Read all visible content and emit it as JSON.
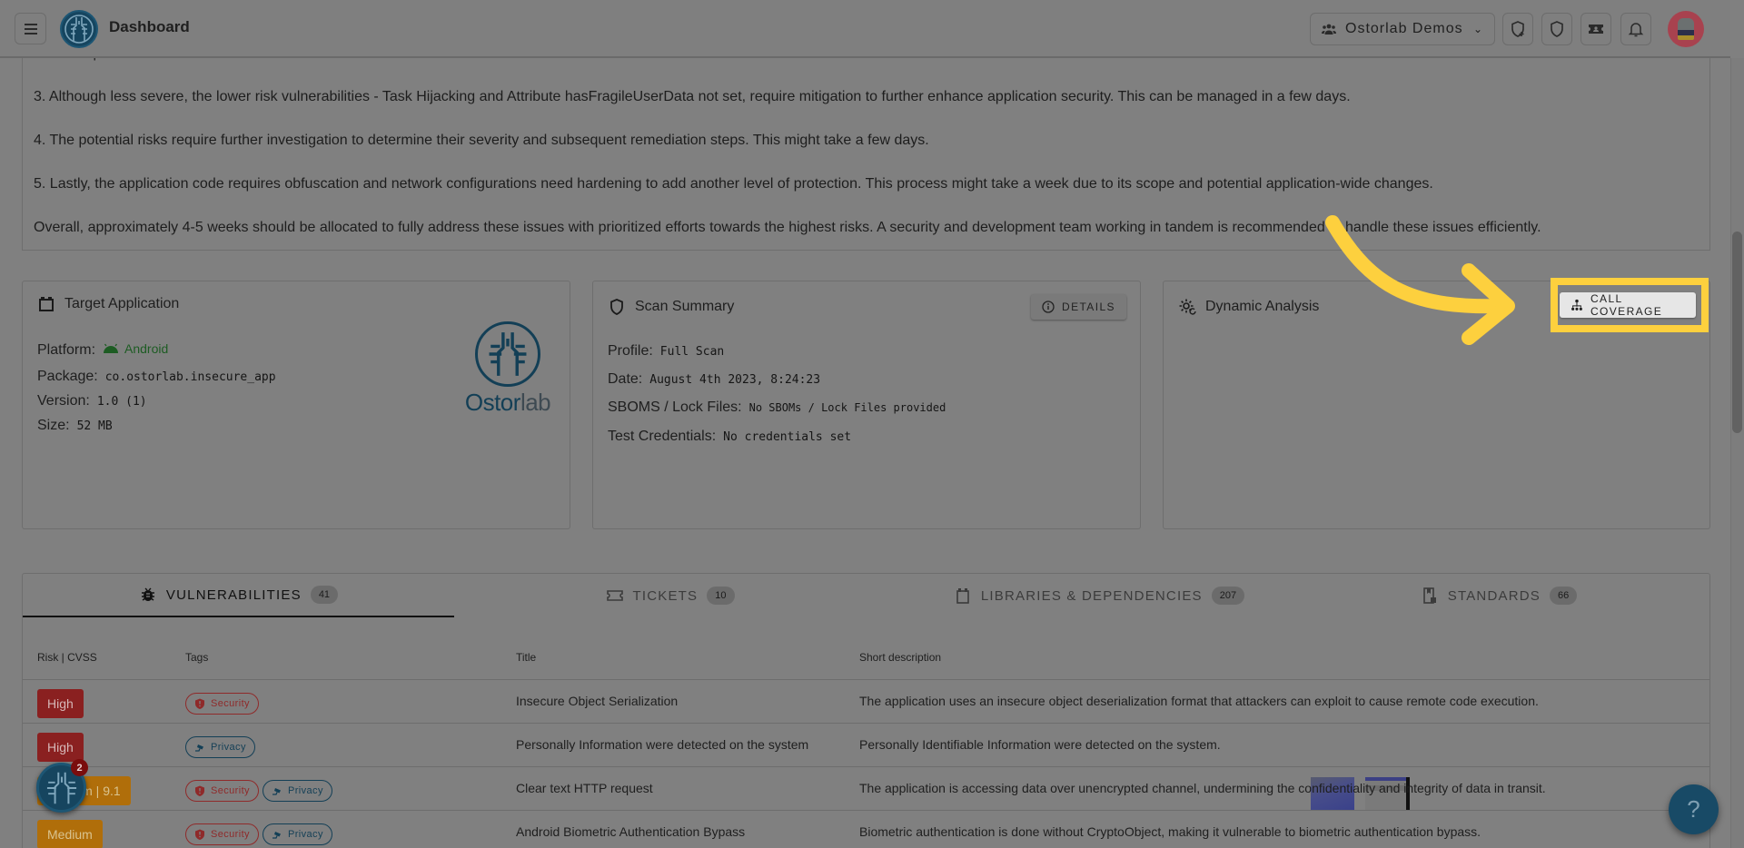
{
  "header": {
    "title": "Dashboard",
    "organization": "Ostorlab Demos",
    "icons": [
      "menu-icon",
      "ostorlab-logo",
      "users-icon",
      "chevron-down-icon",
      "shield-plus-icon",
      "shield-icon",
      "ticket-icon",
      "bell-icon",
      "avatar"
    ]
  },
  "recommendations": {
    "partial_line": "HTTP requests. This can take around one week.",
    "paragraphs": [
      "3. Although less severe, the lower risk vulnerabilities - Task Hijacking and Attribute hasFragileUserData not set, require mitigation to further enhance application security. This can be managed in a few days.",
      "4. The potential risks require further investigation to determine their severity and subsequent remediation steps. This might take a few days.",
      "5. Lastly, the application code requires obfuscation and network configurations need hardening to add another level of protection. This process might take a week due to its scope and potential application-wide changes.",
      "Overall, approximately 4-5 weeks should be allocated to fully address these issues with prioritized efforts towards the highest risks. A security and development team working in tandem is recommended to handle these issues efficiently."
    ]
  },
  "target_application": {
    "title": "Target Application",
    "platform_label": "Platform:",
    "platform_value": "Android",
    "package_label": "Package:",
    "package_value": "co.ostorlab.insecure_app",
    "version_label": "Version:",
    "version_value": "1.0 (1)",
    "size_label": "Size:",
    "size_value": "52 MB",
    "logo_word_a": "Ostor",
    "logo_word_b": "lab"
  },
  "scan_summary": {
    "title": "Scan Summary",
    "details_button": "DETAILS",
    "profile_label": "Profile:",
    "profile_value": "Full Scan",
    "date_label": "Date:",
    "date_value": "August 4th 2023, 8:24:23",
    "sboms_label": "SBOMS / Lock Files:",
    "sboms_value": "No SBOMs / Lock Files provided",
    "credentials_label": "Test Credentials:",
    "credentials_value": "No credentials set"
  },
  "dynamic_analysis": {
    "title": "Dynamic Analysis",
    "call_coverage_button": "CALL COVERAGE"
  },
  "tabs": [
    {
      "label": "VULNERABILITIES",
      "count": "41",
      "active": true
    },
    {
      "label": "TICKETS",
      "count": "10",
      "active": false
    },
    {
      "label": "LIBRARIES & DEPENDENCIES",
      "count": "207",
      "active": false
    },
    {
      "label": "STANDARDS",
      "count": "66",
      "active": false
    }
  ],
  "table": {
    "columns": [
      "Risk | CVSS",
      "Tags",
      "Title",
      "Short description"
    ],
    "rows": [
      {
        "risk": "High",
        "tags": [
          "Security"
        ],
        "title": "Insecure Object Serialization",
        "description": "The application uses an insecure object deserialization format that attackers can exploit to cause remote code execution."
      },
      {
        "risk": "High",
        "tags": [
          "Privacy"
        ],
        "title": "Personally Information were detected on the system",
        "description": "Personally Identifiable Information were detected on the system."
      },
      {
        "risk": "Medium | 9.1",
        "tags": [
          "Security",
          "Privacy"
        ],
        "title": "Clear text HTTP request",
        "description": "The application is accessing data over unencrypted channel, undermining the confidentiality and integrity of data in transit."
      },
      {
        "risk": "Medium",
        "tags": [
          "Security",
          "Privacy"
        ],
        "title": "Android Biometric Authentication Bypass",
        "description": "Biometric authentication is done without CryptoObject, making it vulnerable to biometric authentication bypass."
      }
    ]
  },
  "floating": {
    "notification_count": "2",
    "help_label": "?"
  },
  "colors": {
    "high": "#8a2020",
    "medium": "#b06e0a",
    "annotation": "#fdd03e",
    "brand": "#133f56"
  }
}
